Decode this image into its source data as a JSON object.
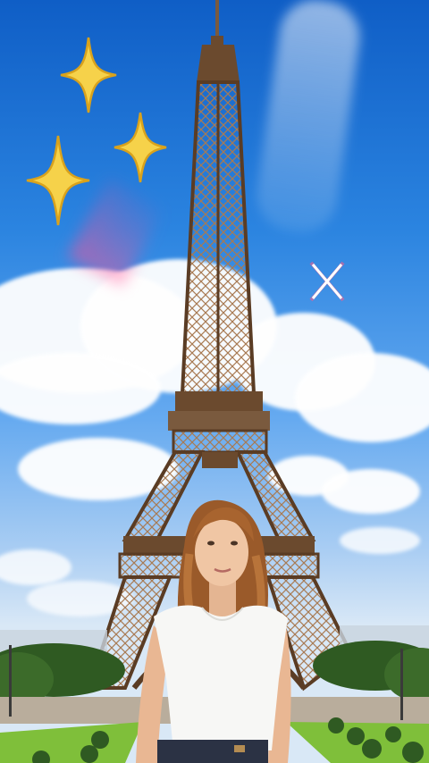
{
  "scene": {
    "description_tags": [
      "sky",
      "clouds",
      "eiffel-tower",
      "woman",
      "park",
      "sparkles"
    ],
    "colors": {
      "sky_top": "#0f5ec6",
      "sky_bottom": "#d9e8f6",
      "tower": "#6b4a2e",
      "tower_light": "#a87a52",
      "sparkle": "#f6d24a",
      "sparkle_outline": "#d9a21c",
      "grass": "#7fbf3a",
      "shirt": "#f7f7f5",
      "hair": "#9a5a2a"
    },
    "icons": [
      "sparkle-icon",
      "sparkle-icon",
      "sparkle-icon",
      "x-mark-icon"
    ]
  }
}
